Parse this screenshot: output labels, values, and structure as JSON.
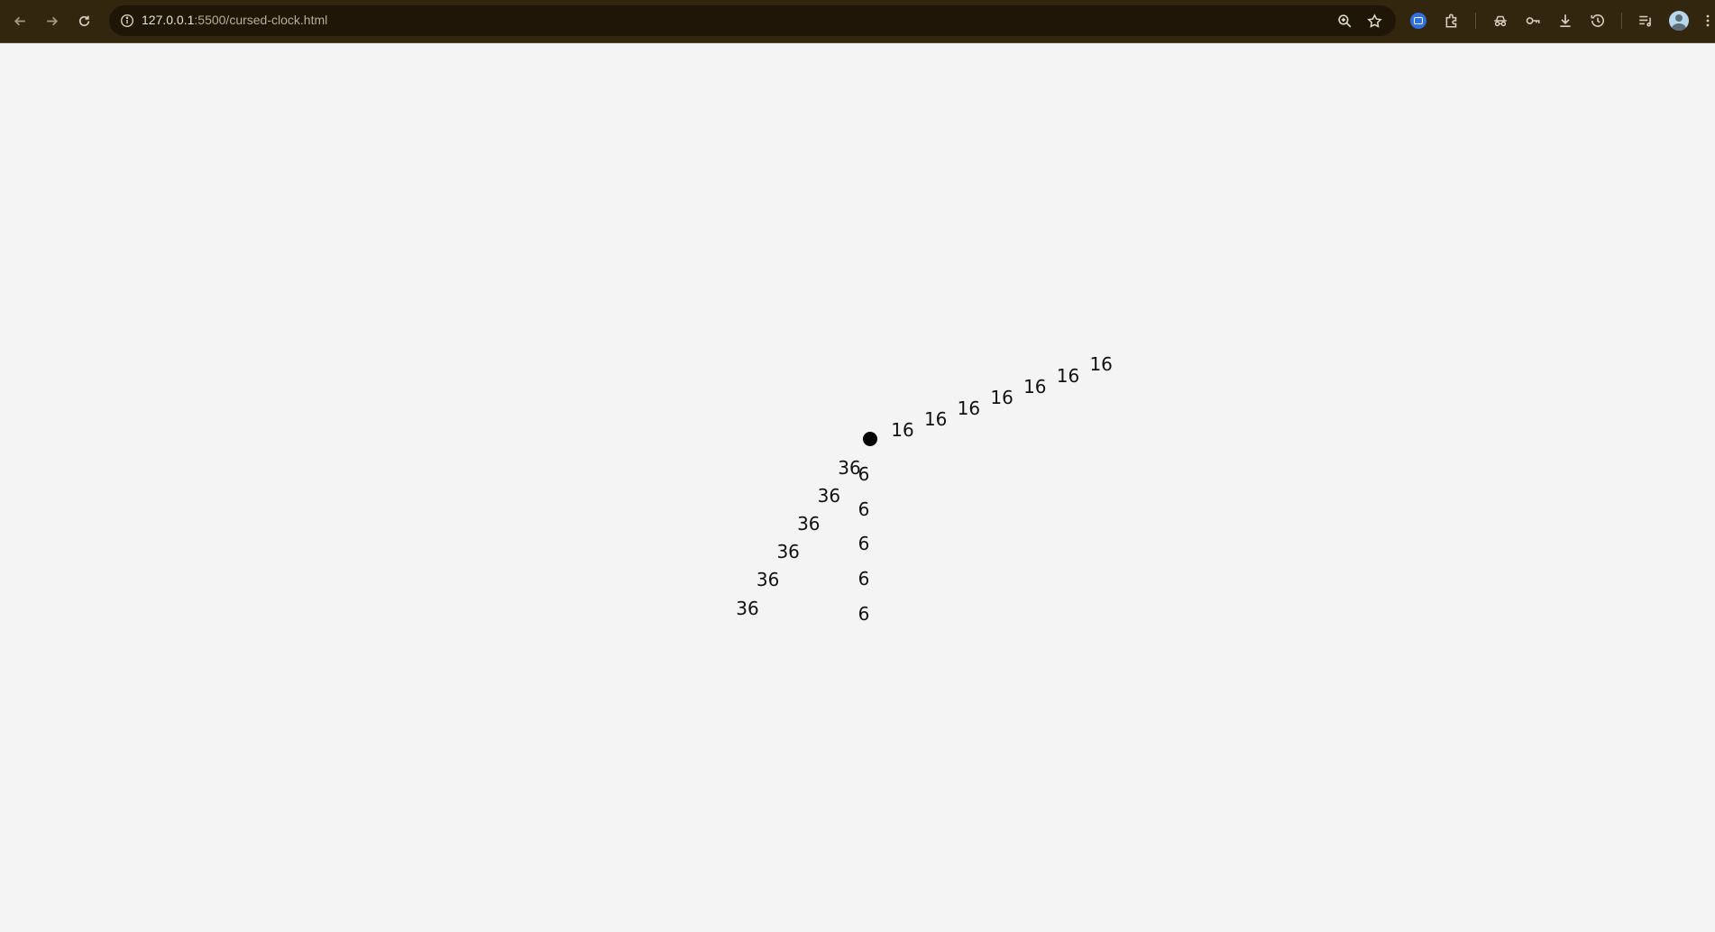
{
  "browser": {
    "url_host": "127.0.0.1",
    "url_path": ":5500/cursed-clock.html",
    "icons": {
      "back": "back-arrow-icon",
      "forward": "forward-arrow-icon",
      "reload": "reload-icon",
      "site_info": "info-icon",
      "zoom": "zoom-icon",
      "bookmark": "star-icon",
      "extension_active": "extension-badge-icon",
      "extensions": "puzzle-icon",
      "incognito": "incognito-icon",
      "passwords": "key-icon",
      "downloads": "download-icon",
      "history": "history-icon",
      "media": "playlist-icon",
      "profile": "avatar-icon",
      "menu": "kebab-menu-icon"
    },
    "accent_color": "#33260f"
  },
  "clock": {
    "hand_a_label": "16",
    "hand_b_label": "6",
    "hand_c_label": "36",
    "hand_a_count": 7,
    "hand_b_count": 5,
    "hand_c_count": 6,
    "dot_color": "#000000"
  }
}
